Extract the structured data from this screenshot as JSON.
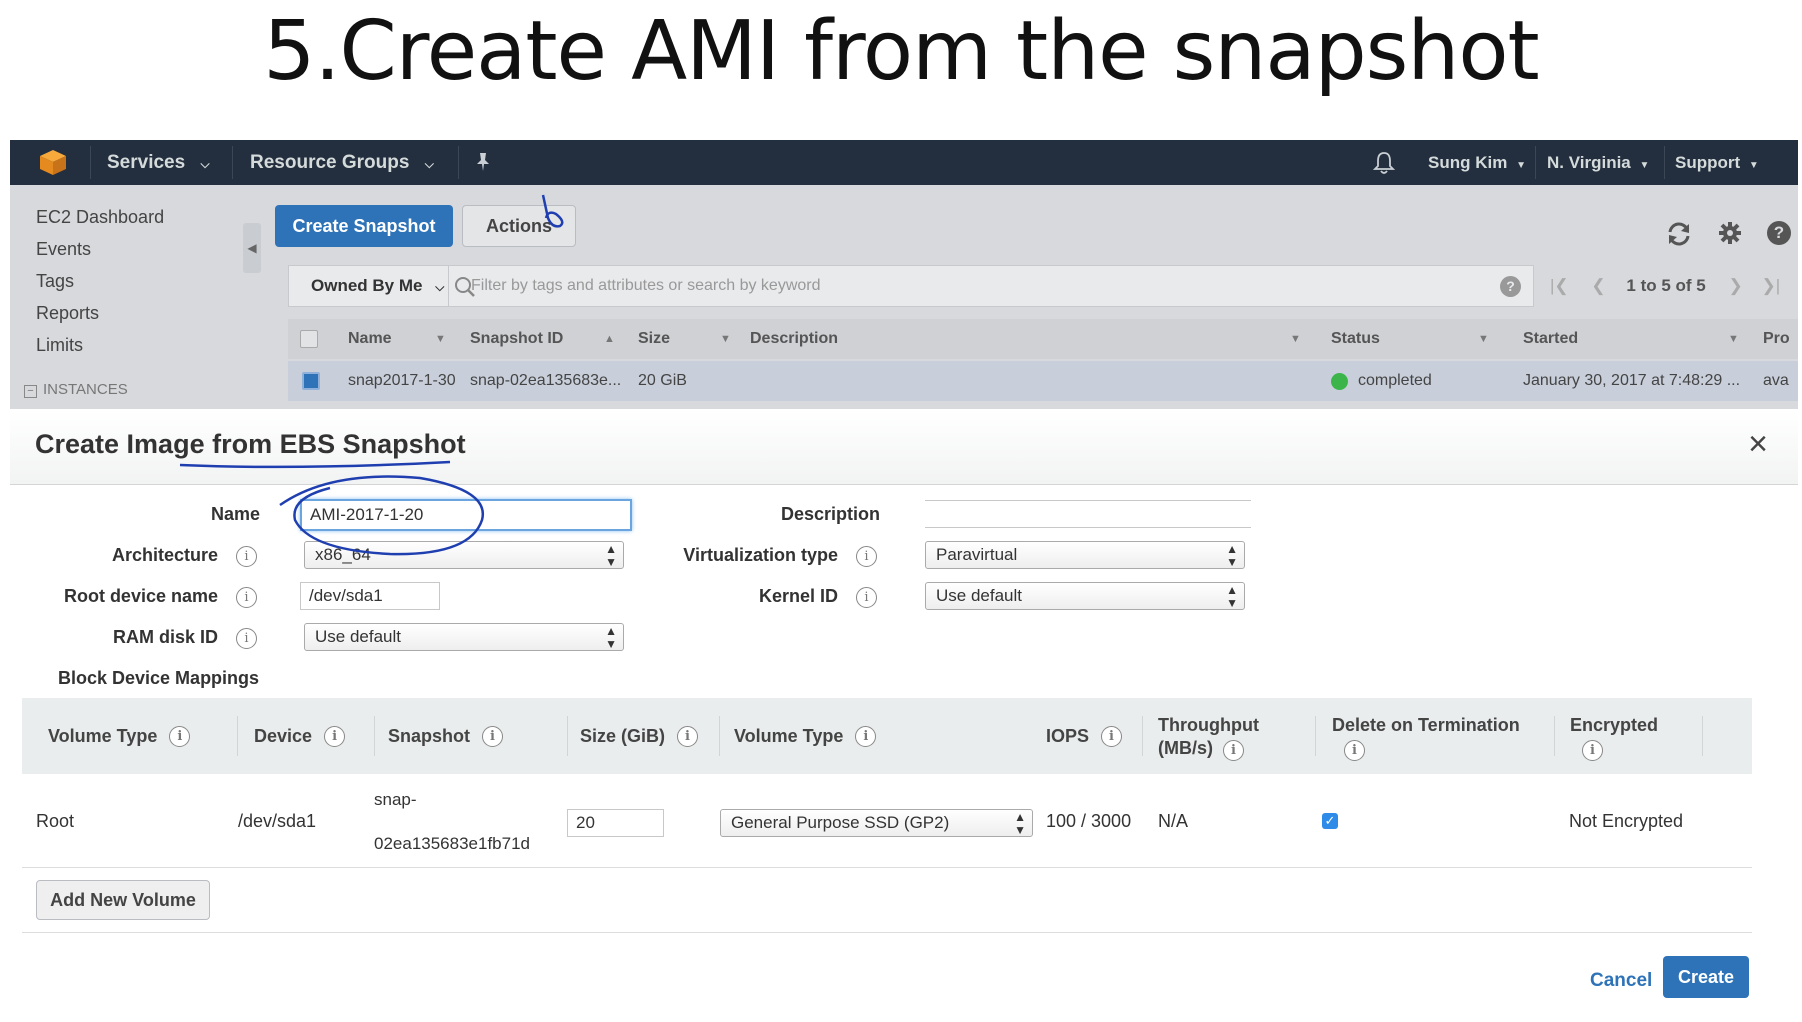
{
  "slide": {
    "title": "5.Create AMI from the snapshot"
  },
  "topnav": {
    "services": "Services",
    "resource_groups": "Resource Groups",
    "user": "Sung Kim",
    "region": "N. Virginia",
    "support": "Support"
  },
  "sidebar": {
    "items": [
      "EC2 Dashboard",
      "Events",
      "Tags",
      "Reports",
      "Limits"
    ],
    "section": "INSTANCES"
  },
  "toolbar": {
    "create_snapshot": "Create Snapshot",
    "actions": "Actions"
  },
  "filter": {
    "owned_by": "Owned By Me",
    "placeholder": "Filter by tags and attributes or search by keyword",
    "pager": "1 to 5 of 5"
  },
  "grid": {
    "columns": [
      "Name",
      "Snapshot ID",
      "Size",
      "Description",
      "Status",
      "Started",
      "Pro"
    ],
    "rows": [
      {
        "name": "snap2017-1-30",
        "snapshot_id": "snap-02ea135683e...",
        "size": "20 GiB",
        "description": "",
        "status": "completed",
        "started": "January 30, 2017 at 7:48:29 ...",
        "progress": "ava"
      }
    ],
    "status_color": "#3bb54a"
  },
  "modal": {
    "title": "Create Image from EBS Snapshot",
    "close": "×",
    "fields": {
      "name_label": "Name",
      "name_value": "AMI-2017-1-20",
      "description_label": "Description",
      "description_value": "",
      "architecture_label": "Architecture",
      "architecture_value": "x86_64",
      "virtualization_label": "Virtualization type",
      "virtualization_value": "Paravirtual",
      "root_device_label": "Root device name",
      "root_device_value": "/dev/sda1",
      "kernel_label": "Kernel ID",
      "kernel_value": "Use default",
      "ramdisk_label": "RAM disk ID",
      "ramdisk_value": "Use default",
      "bdm_label": "Block Device Mappings"
    },
    "bdm": {
      "headers": {
        "volume_type": "Volume Type",
        "device": "Device",
        "snapshot": "Snapshot",
        "size": "Size (GiB)",
        "volume_type2": "Volume Type",
        "iops": "IOPS",
        "throughput_1": "Throughput",
        "throughput_2": "(MB/s)",
        "delete_on_term": "Delete on Termination",
        "encrypted": "Encrypted"
      },
      "row": {
        "volume_type": "Root",
        "device": "/dev/sda1",
        "snapshot_1": "snap-",
        "snapshot_2": "02ea135683e1fb71d",
        "size": "20",
        "ebs_type": "General Purpose SSD (GP2)",
        "iops": "100 / 3000",
        "throughput": "N/A",
        "delete_on_termination": true,
        "encrypted": "Not Encrypted"
      }
    },
    "add_volume": "Add New Volume",
    "cancel": "Cancel",
    "create": "Create"
  },
  "colors": {
    "nav_bg": "#232f3e",
    "primary": "#2e73b8",
    "annotation_ink": "#1f3fb0"
  }
}
